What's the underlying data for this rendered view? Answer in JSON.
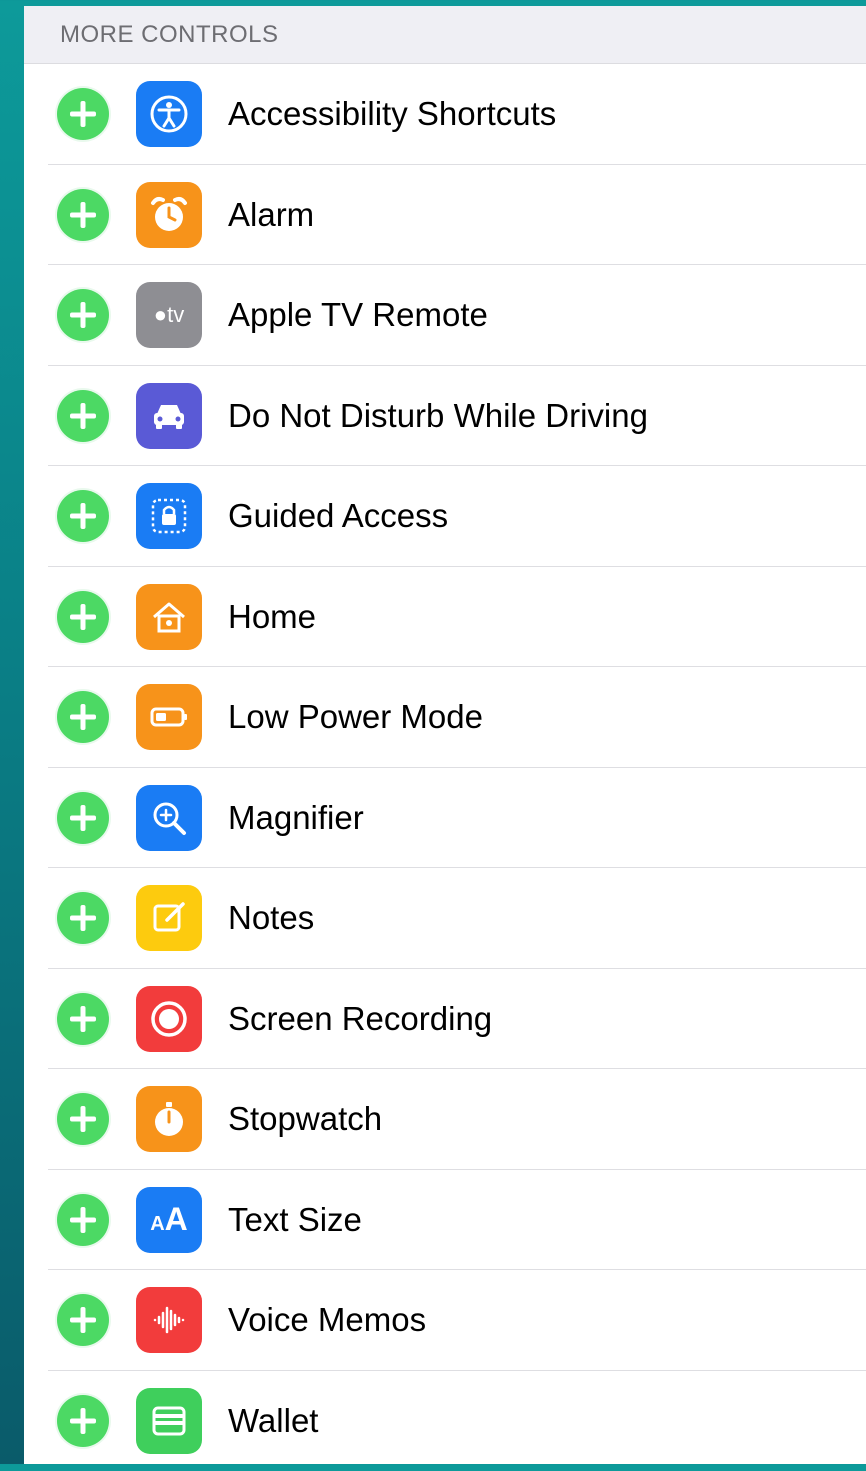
{
  "section": {
    "title": "MORE CONTROLS"
  },
  "controls": [
    {
      "label": "Accessibility Shortcuts",
      "icon": "accessibility-icon",
      "color": "#1a7cf4"
    },
    {
      "label": "Alarm",
      "icon": "alarm-clock-icon",
      "color": "#f7931a"
    },
    {
      "label": "Apple TV Remote",
      "icon": "apple-tv-icon",
      "icon_text": "tv",
      "color": "#8e8e93"
    },
    {
      "label": "Do Not Disturb While Driving",
      "icon": "car-icon",
      "color": "#5a5ad6"
    },
    {
      "label": "Guided Access",
      "icon": "lock-icon",
      "color": "#1a7cf4"
    },
    {
      "label": "Home",
      "icon": "home-icon",
      "color": "#f7931a"
    },
    {
      "label": "Low Power Mode",
      "icon": "battery-icon",
      "color": "#f7931a"
    },
    {
      "label": "Magnifier",
      "icon": "magnifier-icon",
      "color": "#1a7cf4"
    },
    {
      "label": "Notes",
      "icon": "notes-icon",
      "color": "#fdcb0e"
    },
    {
      "label": "Screen Recording",
      "icon": "record-icon",
      "color": "#f23c3c"
    },
    {
      "label": "Stopwatch",
      "icon": "stopwatch-icon",
      "color": "#f7931a"
    },
    {
      "label": "Text Size",
      "icon": "text-size-icon",
      "icon_text": "AA",
      "color": "#1a7cf4"
    },
    {
      "label": "Voice Memos",
      "icon": "waveform-icon",
      "color": "#f23c3c"
    },
    {
      "label": "Wallet",
      "icon": "wallet-icon",
      "color": "#3fcf5c"
    }
  ],
  "colors": {
    "add_button": "#4cd964",
    "background_top": "#0d9a9a"
  }
}
